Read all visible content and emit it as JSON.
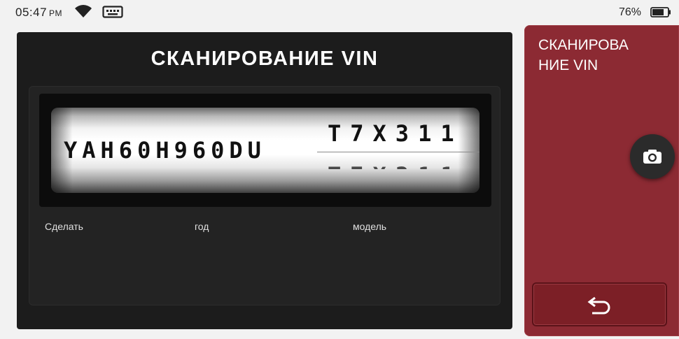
{
  "status_bar": {
    "time": "05:47",
    "ampm": "PM",
    "battery_percent": "76%",
    "wifi_icon": "wifi-icon",
    "terminal_icon": "terminal-icon",
    "battery_icon": "battery-icon"
  },
  "main": {
    "title": "СКАНИРОВАНИЕ VIN",
    "vin_main": "YAH60H960DU",
    "vin_tail": "T7X311",
    "fields": {
      "make_label": "Сделать",
      "year_label": "год",
      "model_label": "модель"
    }
  },
  "side": {
    "title": "СКАНИРОВАНИЕ VIN",
    "camera_icon": "camera-icon",
    "back_icon": "back-arrow-icon"
  },
  "colors": {
    "panel_dark": "#1c1c1c",
    "accent_red": "#8c2a33",
    "back_button": "#7c1f26"
  }
}
